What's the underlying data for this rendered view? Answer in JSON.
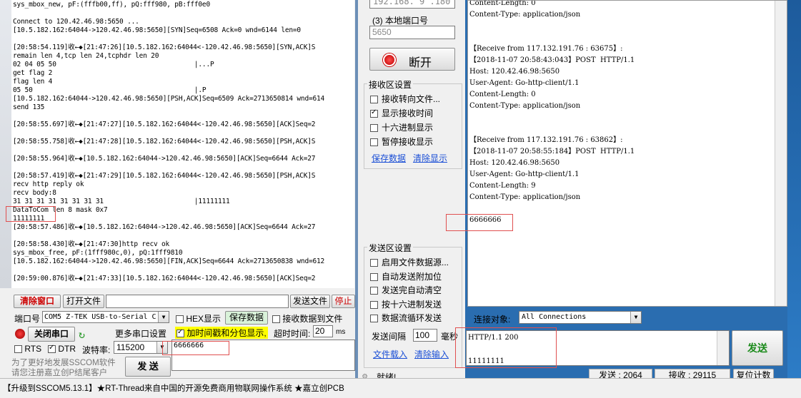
{
  "left_log": {
    "lines": [
      "sys_mbox_new, pF:(fffb00,ff), pQ:fff980, pB:fff0e0",
      "",
      "Connect to 120.42.46.98:5650 ...",
      "[10.5.182.162:64044->120.42.46.98:5650][SYN]Seq=6508 Ack=0 wnd=6144 len=0",
      "",
      "[20:58:54.119]收←◆[21:47:26][10.5.182.162:64044<-120.42.46.98:5650][SYN,ACK]S",
      "remain len 4,tcp len 24,tcphdr len 20",
      "02 04 05 50                                   |...P",
      "get flag 2",
      "flag len 4",
      "05 50                                         |.P",
      "[10.5.182.162:64044->120.42.46.98:5650][PSH,ACK]Seq=6509 Ack=2713650814 wnd=614",
      "send 135",
      "",
      "[20:58:55.697]收←◆[21:47:27][10.5.182.162:64044<-120.42.46.98:5650][ACK]Seq=2",
      "",
      "[20:58:55.758]收←◆[21:47:28][10.5.182.162:64044<-120.42.46.98:5650][PSH,ACK]S",
      "",
      "[20:58:55.964]收←◆[10.5.182.162:64044->120.42.46.98:5650][ACK]Seq=6644 Ack=27",
      "",
      "[20:58:57.419]收←◆[21:47:29][10.5.182.162:64044<-120.42.46.98:5650][PSH,ACK]S",
      "recv http reply ok",
      "recv body:8",
      "31 31 31 31 31 31 31 31                       |11111111",
      "DataToCom len 8 mask 0x7",
      "11111111",
      "[20:58:57.486]收←◆[10.5.182.162:64044->120.42.46.98:5650][ACK]Seq=6644 Ack=27",
      "",
      "[20:58:58.430]收←◆[21:47:30]http recv ok",
      "sys_mbox_free, pF:(1fff980c,0), pQ:1fff9810",
      "[10.5.182.162:64044->120.42.46.98:5650][FIN,ACK]Seq=6644 Ack=2713650838 wnd=612",
      "",
      "[20:59:00.876]收←◆[21:47:33][10.5.182.162:64044<-120.42.46.98:5650][ACK]Seq=2"
    ]
  },
  "left_controls": {
    "clear_window": "清除窗口",
    "open_file": "打开文件",
    "send_file": "发送文件",
    "stop": "停止",
    "port_label": "端口号",
    "port_value": "COM5 Z-TEK USB-to-Serial C",
    "hex_display": "HEX显示",
    "save_data": "保存数据",
    "recv_to_file": "接收数据到文件",
    "close_port": "关闭串口",
    "more_settings": "更多串口设置",
    "timestamp": "加时间戳和分包显示,",
    "timeout_label": "超时时间:",
    "timeout_value": "20",
    "timeout_unit": "ms",
    "rts": "RTS",
    "dtr": "DTR",
    "baud_label": "波特率:",
    "baud_value": "115200",
    "send_input": "6666666",
    "promo_line1": "为了更好地发展SSCOM软件",
    "promo_line2": "请您注册嘉立创P结尾客户",
    "send": "发 送"
  },
  "taskbar": {
    "text": "【升级到SSCOM5.13.1】★RT-Thread来自中国的开源免费商用物联网操作系统 ★嘉立创PCB"
  },
  "mid": {
    "ip_value": "192.168. 9 .180",
    "local_port_label": "(3) 本地端口号",
    "local_port_value": "5650",
    "disconnect": "断开",
    "recv_settings_title": "接收区设置",
    "recv_options": [
      "接收转向文件...",
      "显示接收时间",
      "十六进制显示",
      "暂停接收显示"
    ],
    "recv_checked": [
      false,
      true,
      false,
      false
    ],
    "save_data": "保存数据",
    "clear_display": "清除显示",
    "send_settings_title": "发送区设置",
    "send_options": [
      "启用文件数据源...",
      "自动发送附加位",
      "发送完自动清空",
      "按十六进制发送",
      "数据流循环发送"
    ],
    "interval_label": "发送间隔",
    "interval_value": "100",
    "interval_unit": "毫秒",
    "load_file": "文件载入",
    "clear_input": "清除输入",
    "ready": "就绪!"
  },
  "recv": {
    "lines": [
      "Content-Length: 0",
      "Content-Type: application/json",
      "",
      "",
      "【Receive from 117.132.191.76 : 63675】:",
      "【2018-11-07 20:58:43:043】POST  HTTP/1.1",
      "Host: 120.42.46.98:5650",
      "User-Agent: Go-http-client/1.1",
      "Content-Length: 0",
      "Content-Type: application/json",
      "",
      "",
      "【Receive from 117.132.191.76 : 63862】:",
      "【2018-11-07 20:58:55:184】POST  HTTP/1.1",
      "Host: 120.42.46.98:5650",
      "User-Agent: Go-http-client/1.1",
      "Content-Length: 9",
      "Content-Type: application/json",
      "",
      "6666666"
    ],
    "connect_target_label": "连接对象:",
    "connect_target_value": "All Connections",
    "send_line1": "HTTP/1.1 200",
    "send_line2": "11111111",
    "send_button": "发送",
    "status_send": "发送 : 2064",
    "status_recv": "接收 : 29115",
    "reset_count": "复位计数"
  },
  "colors": {
    "desktop": "#2a6db0",
    "highlight_red": "#e05050",
    "timestamp_bg": "#ffff00"
  }
}
